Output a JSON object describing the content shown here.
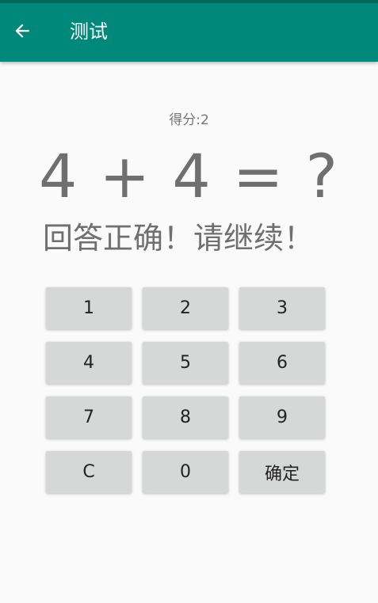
{
  "colors": {
    "status_bar": "#00695c",
    "app_bar": "#00897b",
    "background": "#fafafa",
    "key_background": "#d6d7d7",
    "text_gray": "#6f6f6f"
  },
  "app_bar": {
    "back_icon": "arrow-left-icon",
    "title": "测试"
  },
  "score_text": "得分:2",
  "question_text": "4 + 4 = ?",
  "feedback_text": "回答正确！请继续！",
  "keypad": {
    "keys": [
      {
        "label": "1"
      },
      {
        "label": "2"
      },
      {
        "label": "3"
      },
      {
        "label": "4"
      },
      {
        "label": "5"
      },
      {
        "label": "6"
      },
      {
        "label": "7"
      },
      {
        "label": "8"
      },
      {
        "label": "9"
      },
      {
        "label": "C"
      },
      {
        "label": "0"
      },
      {
        "label": "确定"
      }
    ]
  }
}
